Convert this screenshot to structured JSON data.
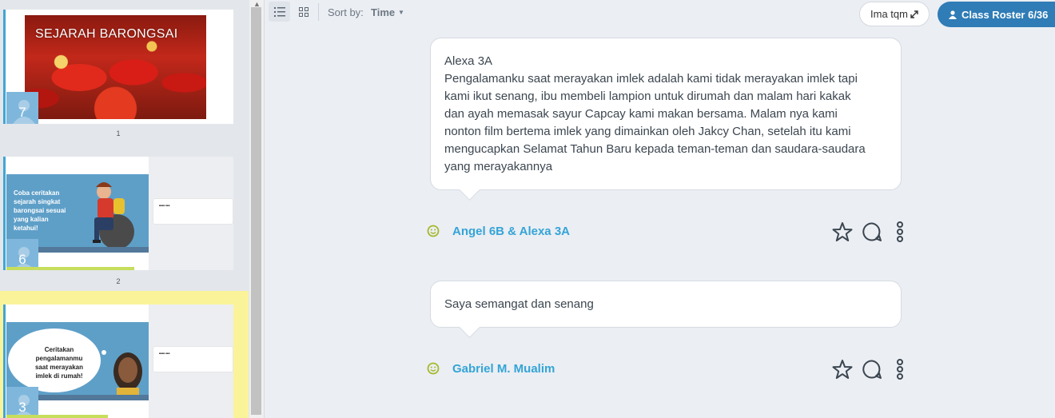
{
  "sidebar": {
    "slides": [
      {
        "title": "SEJARAH BARONGSAI",
        "badge": "7",
        "caption": "1"
      },
      {
        "text": "Coba ceritakan\nsejarah singkat\nbarongsai sesuai\nyang kalian\nketahui!",
        "badge": "6",
        "caption": "2"
      },
      {
        "text": "Ceritakan\npengalamanmu\nsaat merayakan\nimlek di rumah!",
        "badge": "3"
      }
    ]
  },
  "toolbar": {
    "sort_label": "Sort by:",
    "sort_value": "Time",
    "user_button": "Ima tqm",
    "roster_button": "Class Roster 6/36"
  },
  "responses": [
    {
      "text": "Alexa 3A\nPengalamanku saat merayakan imlek adalah kami tidak merayakan imlek tapi\nkami ikut senang, ibu membeli lampion untuk dirumah dan malam hari kakak\ndan ayah memasak sayur Capcay kami makan bersama. Malam nya kami\nnonton film bertema imlek yang dimainkan oleh Jakcy Chan, setelah itu kami\nmengucapkan Selamat Tahun Baru kepada teman-teman dan saudara-saudara\nyang merayakannya",
      "author": "Angel 6B & Alexa 3A"
    },
    {
      "text": "Saya semangat dan senang",
      "author": "Gabriel M. Mualim"
    }
  ],
  "colors": {
    "accent": "#2f7cb6",
    "author": "#34a4d7",
    "smile": "#a4b92a",
    "progress": "#c6de5c",
    "selected_slide": "#fbf39a"
  },
  "icons": [
    "list-view-icon",
    "grid-view-icon",
    "caret-down-icon",
    "expand-icon",
    "user-icon",
    "smile-icon",
    "star-icon",
    "comment-icon",
    "more-vertical-icon"
  ]
}
